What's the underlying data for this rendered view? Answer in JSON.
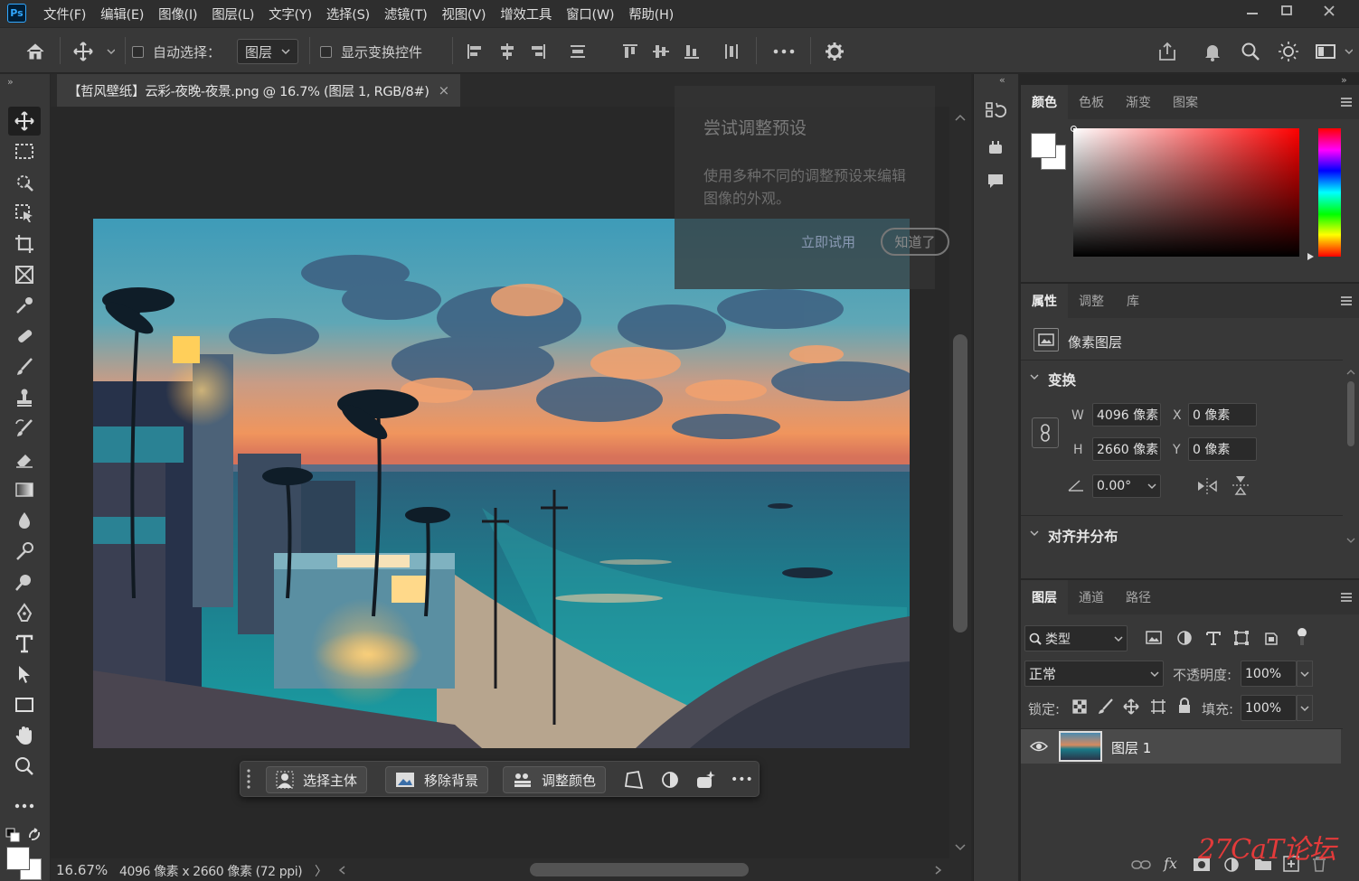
{
  "app": {
    "logo": "Ps"
  },
  "menu": [
    "文件(F)",
    "编辑(E)",
    "图像(I)",
    "图层(L)",
    "文字(Y)",
    "选择(S)",
    "滤镜(T)",
    "视图(V)",
    "增效工具",
    "窗口(W)",
    "帮助(H)"
  ],
  "options": {
    "auto_select_label": "自动选择：",
    "auto_select_target": "图层",
    "show_transform_label": "显示变换控件"
  },
  "document": {
    "tab_title": "【哲风壁纸】云彩-夜晚-夜景.png @ 16.7% (图层 1, RGB/8#)",
    "close_glyph": "×"
  },
  "tip": {
    "title": "尝试调整预设",
    "body_line1": "使用多种不同的调整预设来编辑",
    "body_line2": "图像的外观。",
    "try_button": "立即试用",
    "dismiss_button": "知道了"
  },
  "context_bar": {
    "select_subject": "选择主体",
    "remove_bg": "移除背景",
    "adjust_color": "调整颜色",
    "more": "•••"
  },
  "status": {
    "zoom": "16.67%",
    "doc_info": "4096 像素 x 2660 像素 (72 ppi)",
    "arrow": "〉"
  },
  "color_panel": {
    "tabs": [
      "颜色",
      "色板",
      "渐变",
      "图案"
    ],
    "foreground": "#ffffff",
    "background": "#ffffff",
    "hue_color": "#ff0000"
  },
  "properties_panel": {
    "tabs": [
      "属性",
      "调整",
      "库"
    ],
    "layer_type": "像素图层",
    "transform_title": "变换",
    "w_label": "W",
    "w_value": "4096 像素",
    "h_label": "H",
    "h_value": "2660 像素",
    "x_label": "X",
    "x_value": "0 像素",
    "y_label": "Y",
    "y_value": "0 像素",
    "angle_value": "0.00°",
    "align_title": "对齐并分布"
  },
  "layers_panel": {
    "tabs": [
      "图层",
      "通道",
      "路径"
    ],
    "filter_label": "类型",
    "blend_mode": "正常",
    "opacity_label": "不透明度:",
    "opacity_value": "100%",
    "lock_label": "锁定:",
    "fill_label": "填充:",
    "fill_value": "100%",
    "layers": [
      {
        "name": "图层 1",
        "visible": true
      }
    ],
    "footer_fx": "fx"
  },
  "watermark": "27CaT论坛"
}
